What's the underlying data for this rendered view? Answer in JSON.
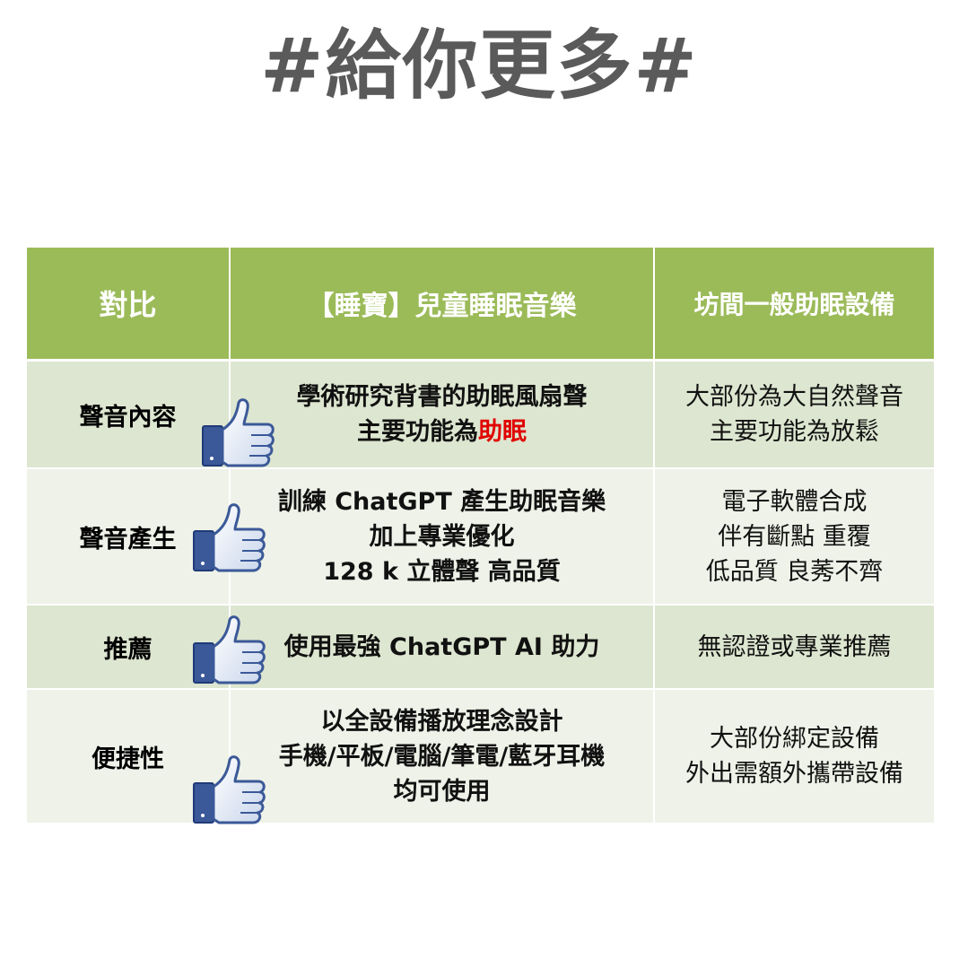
{
  "title": "#給你更多#",
  "table": {
    "headers": [
      "對比",
      "【睡寶】兒童睡眠音樂",
      "坊間一般助眠設備"
    ],
    "rows": [
      {
        "label": "聲音內容",
        "ours": [
          "學術研究背書的助眠風扇聲",
          "主要功能為",
          "助眠"
        ],
        "others": [
          "大部份為大自然聲音",
          "主要功能為放鬆"
        ]
      },
      {
        "label": "聲音產生",
        "ours": [
          "訓練 ChatGPT 產生助眠音樂",
          "加上專業優化",
          "128 k 立體聲 高品質"
        ],
        "others": [
          "電子軟體合成",
          "伴有斷點 重覆",
          "低品質 良莠不齊"
        ]
      },
      {
        "label": "推薦",
        "ours": [
          "使用最強 ChatGPT AI 助力"
        ],
        "others": [
          "無認證或專業推薦"
        ]
      },
      {
        "label": "便捷性",
        "ours": [
          "以全設備播放理念設計",
          "手機/平板/電腦/筆電/藍牙耳機",
          "均可使用"
        ],
        "others": [
          "大部份綁定設備",
          "外出需額外攜帶設備"
        ]
      }
    ]
  },
  "colors": {
    "header_bg": "#9bbb59",
    "row_dark": "#dde6d0",
    "row_light": "#eef2e8",
    "highlight": "#e00000",
    "title": "#5a5a5a"
  },
  "icons": [
    "thumbs-up-icon"
  ]
}
